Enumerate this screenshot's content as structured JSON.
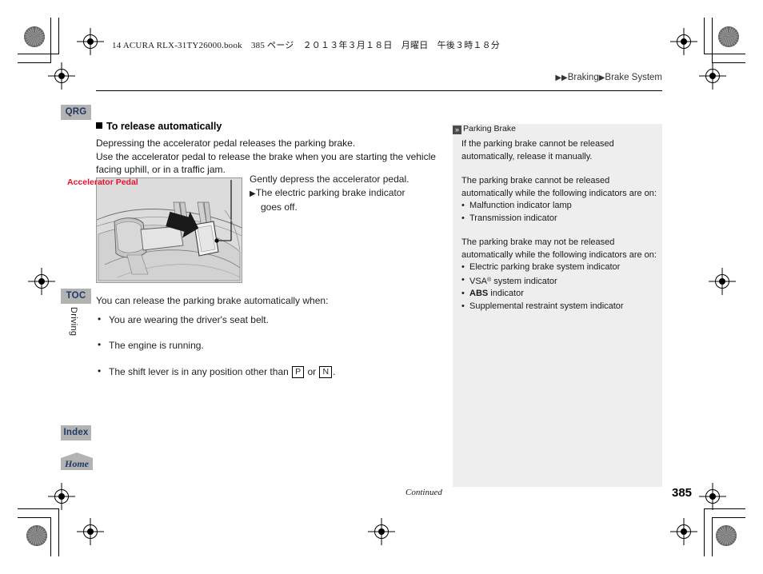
{
  "print": {
    "bookline": "14 ACURA RLX-31TY26000.book　385 ページ　２０１３年３月１８日　月曜日　午後３時１８分"
  },
  "breadcrumb": {
    "arrow1": "▶",
    "arrow2": "▶",
    "level1": "Braking",
    "sep": "▶",
    "level2": "Brake System"
  },
  "nav": {
    "qrg": "QRG",
    "toc": "TOC",
    "index": "Index",
    "home": "Home",
    "section": "Driving"
  },
  "main": {
    "heading": "To release automatically",
    "para1": "Depressing the accelerator pedal releases the parking brake.",
    "para2": "Use the accelerator pedal to release the brake when you are starting the vehicle facing uphill, or in a traffic jam.",
    "figure_label": "Accelerator Pedal",
    "step_text": "Gently depress the accelerator pedal.",
    "step_result_arrow": "▶",
    "step_result": "The electric parking brake indicator",
    "step_result_cont": "goes off.",
    "list_intro": "You can release the parking brake automatically when:",
    "bullets": [
      {
        "pre": "You are wearing the driver's seat belt.",
        "key1": "",
        "mid": "",
        "key2": "",
        "post": ""
      },
      {
        "pre": "The engine is running.",
        "key1": "",
        "mid": "",
        "key2": "",
        "post": ""
      },
      {
        "pre": "The shift lever is in any position other than ",
        "key1": "P",
        "mid": " or ",
        "key2": "N",
        "post": "."
      }
    ]
  },
  "panel": {
    "icon": "»",
    "title": "Parking Brake",
    "para1": "If the parking brake cannot be released automatically, release it manually.",
    "para2": "The parking brake cannot be released automatically while the following indicators are on:",
    "list1": [
      "Malfunction indicator lamp",
      "Transmission indicator"
    ],
    "para3": "The parking brake may not be released automatically while the following indicators are on:",
    "list2_a": "Electric parking brake system indicator",
    "list2_b_pre": "VSA",
    "list2_b_sup": "®",
    "list2_b_post": " system indicator",
    "list2_c_bold": "ABS",
    "list2_c_post": " indicator",
    "list2_d": "Supplemental restraint system indicator"
  },
  "footer": {
    "continued": "Continued",
    "page_number": "385"
  },
  "colors": {
    "accent_red": "#e8112d",
    "tab_bg": "#b3b3b3",
    "tab_text": "#1f3864",
    "panel_bg": "#eeeeee"
  }
}
